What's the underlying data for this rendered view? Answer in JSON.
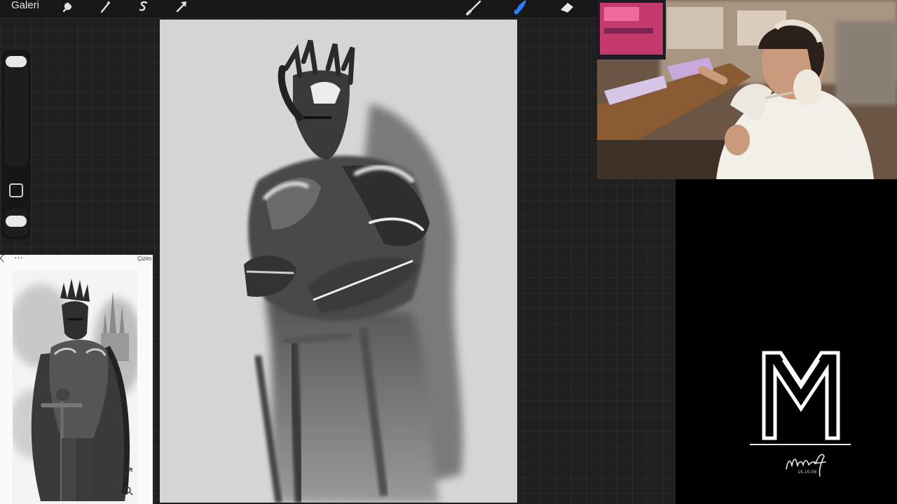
{
  "app": {
    "gallery_label": "Galeri",
    "tools": [
      {
        "name": "wrench-icon"
      },
      {
        "name": "magic-wand-icon"
      },
      {
        "name": "selection-s-icon"
      },
      {
        "name": "transform-arrow-icon"
      },
      {
        "name": "brush-icon"
      },
      {
        "name": "smudge-icon",
        "active": true,
        "color": "#2f7bf6"
      },
      {
        "name": "eraser-icon"
      }
    ]
  },
  "reference": {
    "menu_glyph": "···",
    "title": "Çizim"
  },
  "branding": {
    "signature_date": "15.10.06"
  },
  "colors": {
    "active_tool": "#2f7bf6",
    "canvas": "#d6d6d6",
    "workspace": "#202020"
  }
}
